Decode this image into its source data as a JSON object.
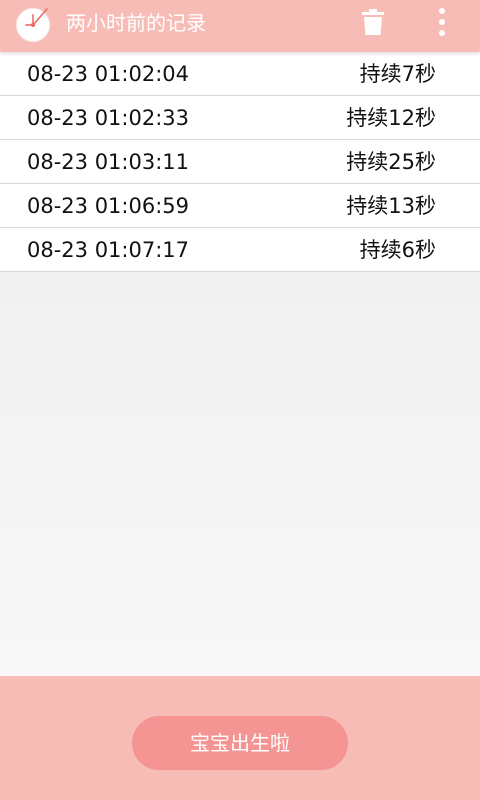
{
  "app_bar": {
    "title": "两小时前的记录",
    "app_icon": "clock-icon",
    "trash_icon": "trash-icon",
    "more_icon": "more-vert-icon",
    "bar_color": "#f8bcb7"
  },
  "records": [
    {
      "time": "08-23 01:02:04",
      "duration": "持续7秒"
    },
    {
      "time": "08-23 01:02:33",
      "duration": "持续12秒"
    },
    {
      "time": "08-23 01:03:11",
      "duration": "持续25秒"
    },
    {
      "time": "08-23 01:06:59",
      "duration": "持续13秒"
    },
    {
      "time": "08-23 01:07:17",
      "duration": "持续6秒"
    }
  ],
  "bottom": {
    "button_label": "宝宝出生啦",
    "button_color": "#f59593"
  }
}
